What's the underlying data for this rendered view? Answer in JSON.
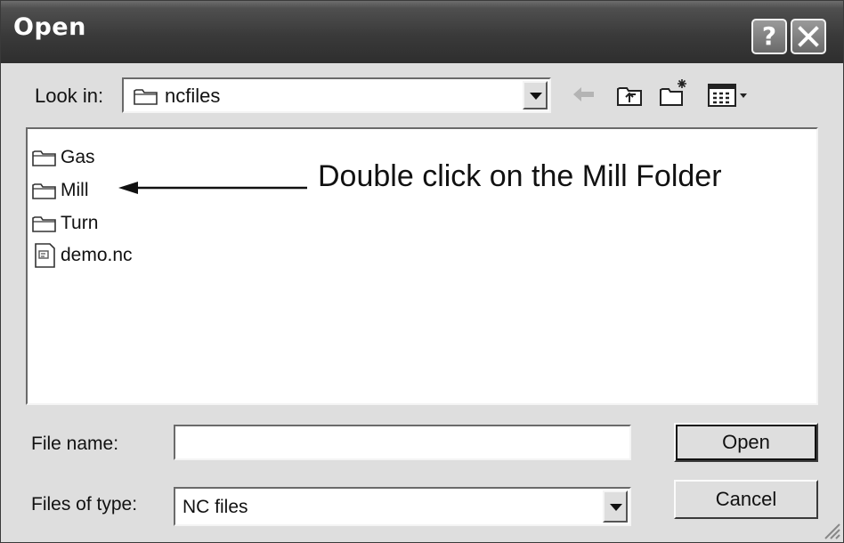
{
  "window": {
    "title": "Open",
    "help_label": "?"
  },
  "look_in": {
    "label": "Look in:",
    "value": "ncfiles"
  },
  "toolbar": {
    "icons": [
      "back-arrow-icon",
      "up-one-level-icon",
      "new-folder-icon",
      "views-menu-icon"
    ]
  },
  "files": [
    {
      "name": "Gas",
      "type": "folder",
      "icon": "folder-icon"
    },
    {
      "name": "Mill",
      "type": "folder",
      "icon": "folder-icon"
    },
    {
      "name": "Turn",
      "type": "folder",
      "icon": "folder-icon"
    },
    {
      "name": "demo.nc",
      "type": "file",
      "icon": "document-icon"
    }
  ],
  "annotation": {
    "text": "Double click on the Mill Folder"
  },
  "file_name": {
    "label": "File name:",
    "value": ""
  },
  "file_type": {
    "label": "Files of type:",
    "value": "NC files"
  },
  "buttons": {
    "open": "Open",
    "cancel": "Cancel"
  },
  "colors": {
    "title_bar": "#3a3a3a",
    "window_bg": "#dedede",
    "list_bg": "#ffffff"
  }
}
